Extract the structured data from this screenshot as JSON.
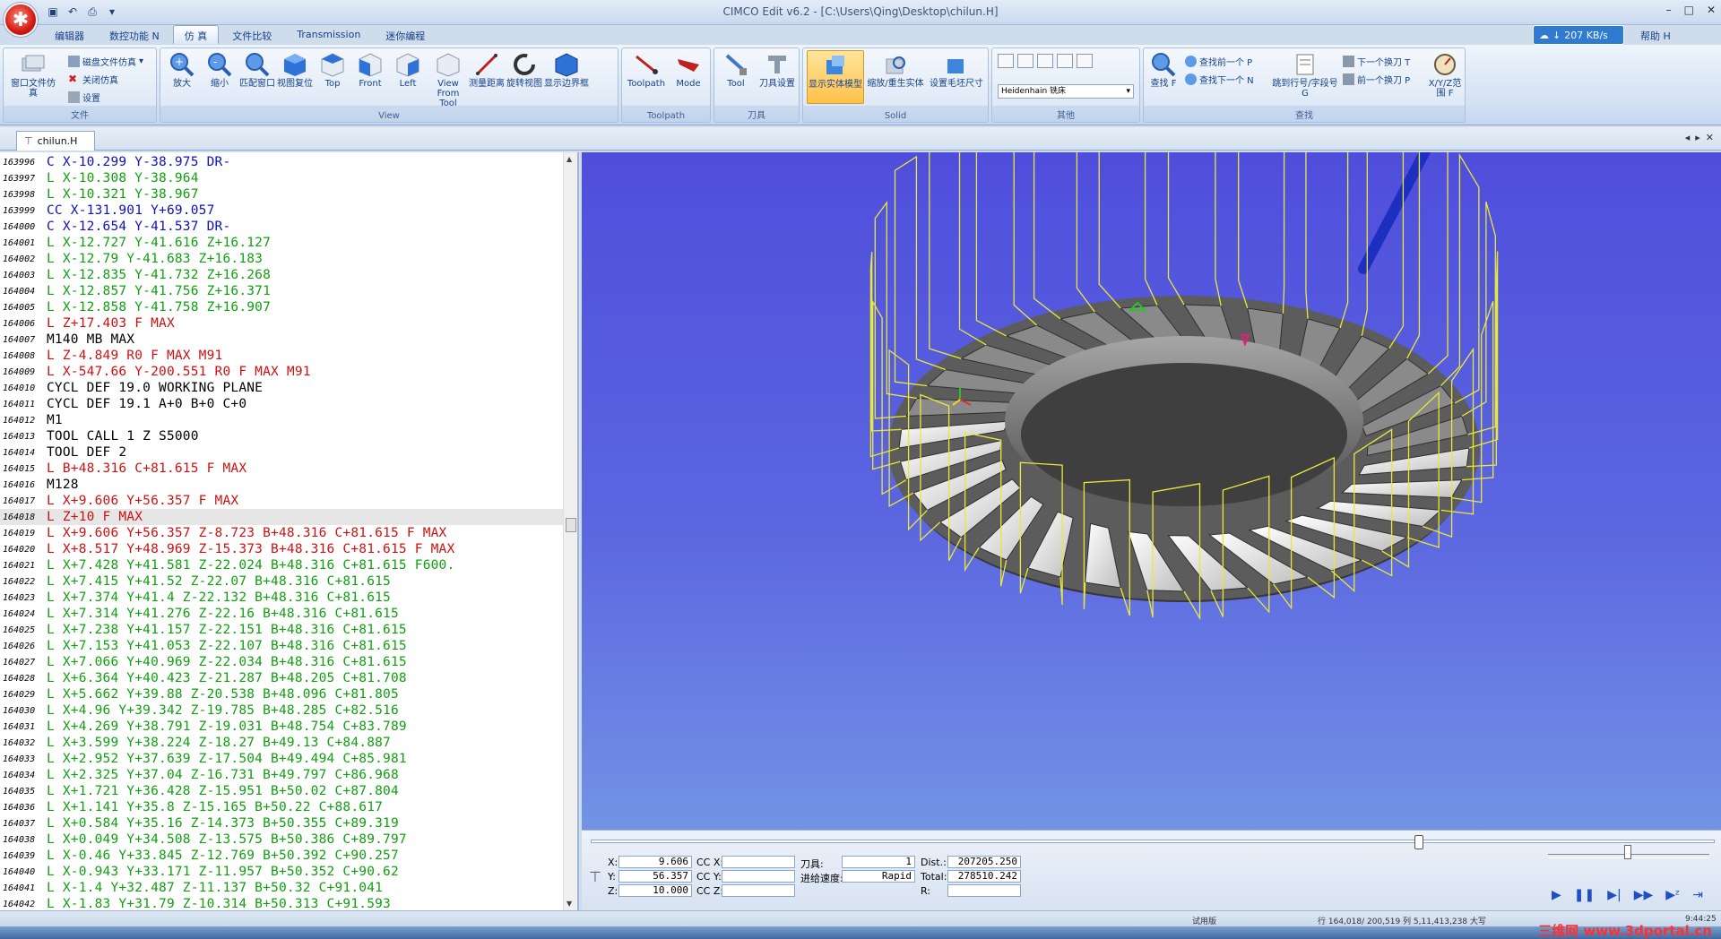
{
  "app": {
    "title": "CIMCO Edit v6.2 - [C:\\Users\\Qing\\Desktop\\chilun.H]",
    "net_speed": "207 KB/s",
    "help": "帮助 H",
    "win_controls": [
      "–",
      "□",
      "✕"
    ]
  },
  "tabs": [
    "编辑器",
    "数控功能 N",
    "仿 真",
    "文件比较",
    "Transmission",
    "迷你编程"
  ],
  "ribbon": {
    "file": {
      "label": "文件",
      "side": [
        "磁盘文件仿真",
        "关闭仿真",
        "设置"
      ],
      "big": "窗口文件仿真"
    },
    "view": {
      "label": "View",
      "buttons": [
        "放大",
        "缩小",
        "匹配窗口",
        "视图复位",
        "Top",
        "Front",
        "Left",
        "View From Tool",
        "测量距离",
        "旋转视图",
        "显示边界框"
      ]
    },
    "toolpath": {
      "label": "Toolpath",
      "buttons": [
        "Toolpath",
        "Mode"
      ]
    },
    "tool": {
      "label": "刀具",
      "buttons": [
        "Tool",
        "刀具设置"
      ]
    },
    "solid": {
      "label": "Solid",
      "buttons": [
        "显示实体模型",
        "缩放/重生实体",
        "设置毛坯尺寸"
      ]
    },
    "other": {
      "label": "其他",
      "dropdown": "Heidenhain 铣床"
    },
    "find": {
      "label": "查找",
      "buttons": [
        "查找 F",
        "查找前一个 P",
        "查找下一个 N",
        "跳到行号/字段号 G",
        "下一个换刀 T",
        "前一个换刀 P",
        "X/Y/Z范围 F"
      ]
    }
  },
  "doc_tab": "chilun.H",
  "code": [
    {
      "n": "163996",
      "t": "C X-10.299 Y-38.975 DR-",
      "c": "#1010c0"
    },
    {
      "n": "163997",
      "t": "L X-10.308 Y-38.964",
      "c": "#10a010"
    },
    {
      "n": "163998",
      "t": "L X-10.321 Y-38.967",
      "c": "#10a010"
    },
    {
      "n": "163999",
      "t": "CC X-131.901 Y+69.057",
      "c": "#1010c0"
    },
    {
      "n": "164000",
      "t": "C X-12.654 Y-41.537 DR-",
      "c": "#1010c0"
    },
    {
      "n": "164001",
      "t": "L X-12.727 Y-41.616 Z+16.127",
      "c": "#10a010"
    },
    {
      "n": "164002",
      "t": "L X-12.79 Y-41.683 Z+16.183",
      "c": "#10a010"
    },
    {
      "n": "164003",
      "t": "L X-12.835 Y-41.732 Z+16.268",
      "c": "#10a010"
    },
    {
      "n": "164004",
      "t": "L X-12.857 Y-41.756 Z+16.371",
      "c": "#10a010"
    },
    {
      "n": "164005",
      "t": "L X-12.858 Y-41.758 Z+16.907",
      "c": "#10a010"
    },
    {
      "n": "164006",
      "t": "L Z+17.403 F MAX",
      "c": "#d01010"
    },
    {
      "n": "164007",
      "t": "M140 MB MAX",
      "c": "#000000"
    },
    {
      "n": "164008",
      "t": "L Z-4.849 R0 F MAX M91",
      "c": "#d01010"
    },
    {
      "n": "164009",
      "t": "L X-547.66 Y-200.551 R0 F MAX M91",
      "c": "#d01010"
    },
    {
      "n": "164010",
      "t": "CYCL DEF 19.0 WORKING PLANE",
      "c": "#000000"
    },
    {
      "n": "164011",
      "t": "CYCL DEF 19.1 A+0 B+0 C+0",
      "c": "#000000"
    },
    {
      "n": "164012",
      "t": "M1",
      "c": "#000000"
    },
    {
      "n": "164013",
      "t": "TOOL CALL 1 Z S5000",
      "c": "#000000"
    },
    {
      "n": "164014",
      "t": "TOOL DEF 2",
      "c": "#000000"
    },
    {
      "n": "164015",
      "t": "L B+48.316 C+81.615 F MAX",
      "c": "#d01010"
    },
    {
      "n": "164016",
      "t": "M128",
      "c": "#000000"
    },
    {
      "n": "164017",
      "t": "L X+9.606 Y+56.357 F MAX",
      "c": "#d01010"
    },
    {
      "n": "164018",
      "t": "L Z+10 F MAX",
      "c": "#d01010",
      "sel": true
    },
    {
      "n": "164019",
      "t": "L X+9.606 Y+56.357 Z-8.723 B+48.316 C+81.615 F MAX",
      "c": "#d01010"
    },
    {
      "n": "164020",
      "t": "L X+8.517 Y+48.969 Z-15.373 B+48.316 C+81.615 F MAX",
      "c": "#d01010"
    },
    {
      "n": "164021",
      "t": "L X+7.428 Y+41.581 Z-22.024 B+48.316 C+81.615 F600.",
      "c": "#10a010"
    },
    {
      "n": "164022",
      "t": "L X+7.415 Y+41.52 Z-22.07 B+48.316 C+81.615",
      "c": "#10a010"
    },
    {
      "n": "164023",
      "t": "L X+7.374 Y+41.4 Z-22.132 B+48.316 C+81.615",
      "c": "#10a010"
    },
    {
      "n": "164024",
      "t": "L X+7.314 Y+41.276 Z-22.16 B+48.316 C+81.615",
      "c": "#10a010"
    },
    {
      "n": "164025",
      "t": "L X+7.238 Y+41.157 Z-22.151 B+48.316 C+81.615",
      "c": "#10a010"
    },
    {
      "n": "164026",
      "t": "L X+7.153 Y+41.053 Z-22.107 B+48.316 C+81.615",
      "c": "#10a010"
    },
    {
      "n": "164027",
      "t": "L X+7.066 Y+40.969 Z-22.034 B+48.316 C+81.615",
      "c": "#10a010"
    },
    {
      "n": "164028",
      "t": "L X+6.364 Y+40.423 Z-21.287 B+48.205 C+81.708",
      "c": "#10a010"
    },
    {
      "n": "164029",
      "t": "L X+5.662 Y+39.88 Z-20.538 B+48.096 C+81.805",
      "c": "#10a010"
    },
    {
      "n": "164030",
      "t": "L X+4.96 Y+39.342 Z-19.785 B+48.285 C+82.516",
      "c": "#10a010"
    },
    {
      "n": "164031",
      "t": "L X+4.269 Y+38.791 Z-19.031 B+48.754 C+83.789",
      "c": "#10a010"
    },
    {
      "n": "164032",
      "t": "L X+3.599 Y+38.224 Z-18.27 B+49.13 C+84.887",
      "c": "#10a010"
    },
    {
      "n": "164033",
      "t": "L X+2.952 Y+37.639 Z-17.504 B+49.494 C+85.981",
      "c": "#10a010"
    },
    {
      "n": "164034",
      "t": "L X+2.325 Y+37.04 Z-16.731 B+49.797 C+86.968",
      "c": "#10a010"
    },
    {
      "n": "164035",
      "t": "L X+1.721 Y+36.428 Z-15.951 B+50.02 C+87.804",
      "c": "#10a010"
    },
    {
      "n": "164036",
      "t": "L X+1.141 Y+35.8 Z-15.165 B+50.22 C+88.617",
      "c": "#10a010"
    },
    {
      "n": "164037",
      "t": "L X+0.584 Y+35.16 Z-14.373 B+50.355 C+89.319",
      "c": "#10a010"
    },
    {
      "n": "164038",
      "t": "L X+0.049 Y+34.508 Z-13.575 B+50.386 C+89.797",
      "c": "#10a010"
    },
    {
      "n": "164039",
      "t": "L X-0.46 Y+33.845 Z-12.769 B+50.392 C+90.257",
      "c": "#10a010"
    },
    {
      "n": "164040",
      "t": "L X-0.943 Y+33.171 Z-11.957 B+50.352 C+90.62",
      "c": "#10a010"
    },
    {
      "n": "164041",
      "t": "L X-1.4 Y+32.487 Z-11.137 B+50.32 C+91.041",
      "c": "#10a010"
    },
    {
      "n": "164042",
      "t": "L X-1.83 Y+31.79 Z-10.314 B+50.313 C+91.593",
      "c": "#10a010"
    }
  ],
  "sim": {
    "x_label": "X:",
    "y_label": "Y:",
    "z_label": "Z:",
    "x": "9.606",
    "y": "56.357",
    "z": "10.000",
    "ccx_label": "CC X:",
    "ccy_label": "CC Y:",
    "ccz_label": "CC Z:",
    "tool_label": "刀具:",
    "tool": "1",
    "feed_label": "进给速度:",
    "feed": "Rapid",
    "dist_label": "Dist.:",
    "dist": "207205.250",
    "total_label": "Total:",
    "total": "278510.242",
    "r_label": "R:",
    "timeline_progress": 0.736
  },
  "status": {
    "mode": "试用版",
    "pos": "行 164,018/ 200,519  列 5,11,413,238  大写",
    "time": "9:44:25"
  },
  "watermark": "三维网 www.3dportal.cn"
}
